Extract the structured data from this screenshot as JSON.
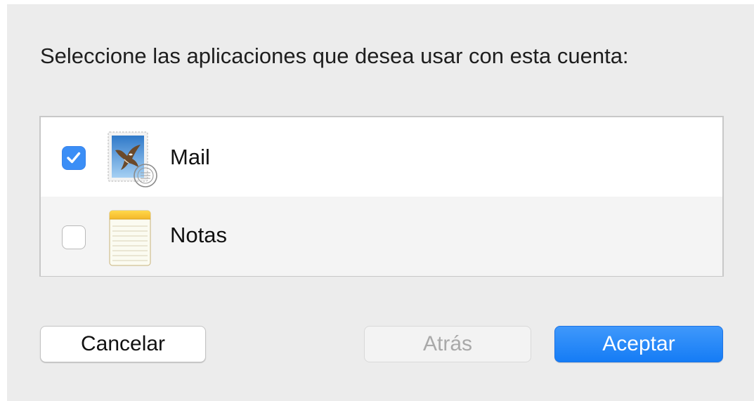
{
  "dialog": {
    "prompt": "Seleccione las aplicaciones que desea usar con esta cuenta:"
  },
  "apps": [
    {
      "name": "Mail",
      "checked": true,
      "icon": "mail-stamp-icon"
    },
    {
      "name": "Notas",
      "checked": false,
      "icon": "notes-pad-icon"
    }
  ],
  "buttons": {
    "cancel_label": "Cancelar",
    "back_label": "Atrás",
    "accept_label": "Aceptar"
  },
  "colors": {
    "accent": "#3b8ef6",
    "dialog_background": "#ececec"
  }
}
